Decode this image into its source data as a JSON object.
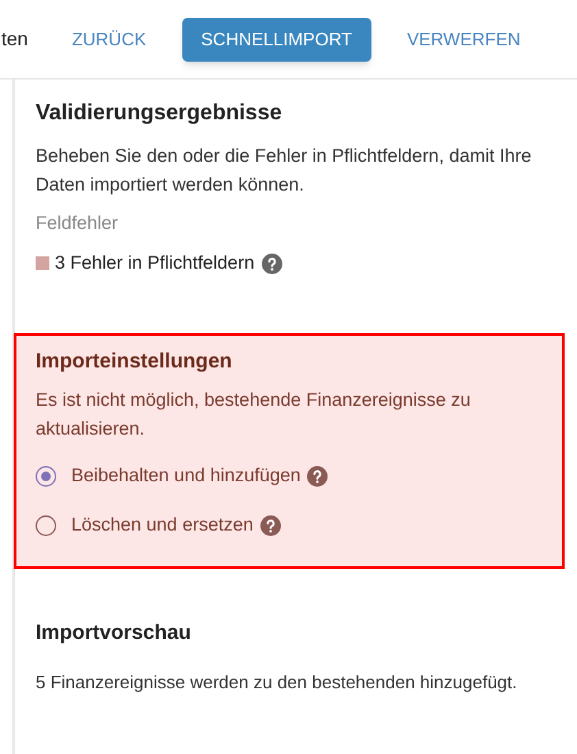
{
  "toolbar": {
    "cut_label": "ten",
    "buttons": [
      {
        "label": "ZURÜCK",
        "selected": false
      },
      {
        "label": "SCHNELLIMPORT",
        "selected": true
      },
      {
        "label": "VERWERFEN",
        "selected": false
      }
    ]
  },
  "validation": {
    "title": "Validierungsergebnisse",
    "description": "Beheben Sie den oder die Fehler in Pflichtfeldern, damit Ihre Daten importiert werden können.",
    "subtitle": "Feldfehler",
    "errors": [
      {
        "label": "3 Fehler in Pflichtfeldern",
        "color": "#d4a5a0"
      }
    ]
  },
  "import_settings": {
    "title": "Importeinstellungen",
    "description": "Es ist nicht möglich, bestehende Finanzereignisse zu aktualisieren.",
    "options": [
      {
        "label": "Beibehalten und hinzufügen",
        "selected": true
      },
      {
        "label": "Löschen und ersetzen",
        "selected": false
      }
    ]
  },
  "preview": {
    "title": "Importvorschau",
    "description": "5 Finanzereignisse werden zu den bestehenden hinzugefügt."
  }
}
